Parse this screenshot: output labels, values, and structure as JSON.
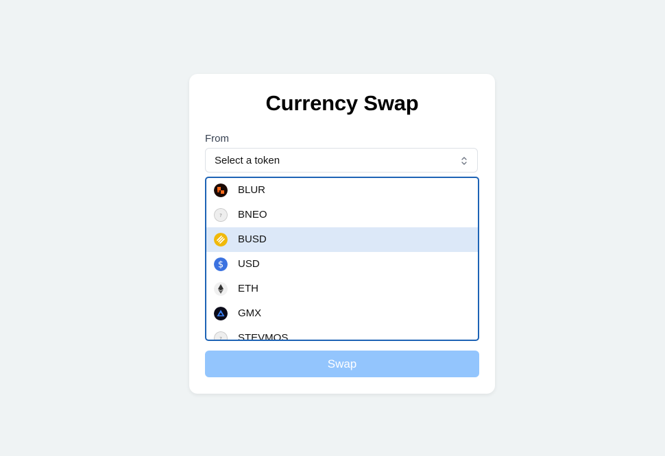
{
  "title": "Currency Swap",
  "from": {
    "label": "From",
    "select_value": "Select a token",
    "selected_option": "BUSD"
  },
  "options": [
    {
      "label": "BLUR",
      "icon": "blur-token-icon"
    },
    {
      "label": "BNEO",
      "icon": "unknown-token-icon"
    },
    {
      "label": "BUSD",
      "icon": "busd-token-icon"
    },
    {
      "label": "USD",
      "icon": "usd-token-icon"
    },
    {
      "label": "ETH",
      "icon": "eth-token-icon"
    },
    {
      "label": "GMX",
      "icon": "gmx-token-icon"
    },
    {
      "label": "STEVMOS",
      "icon": "unknown-token-icon"
    }
  ],
  "swap_button": "Swap",
  "colors": {
    "background": "#eff3f4",
    "listbox_border": "#1d63b5",
    "highlight": "#dce8f8",
    "swap_disabled": "#93c5fd"
  }
}
